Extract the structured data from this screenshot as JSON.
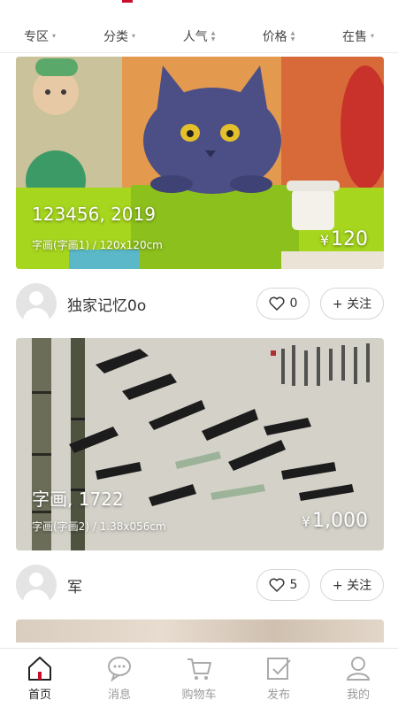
{
  "filters": [
    {
      "label": "专区",
      "indicator": "▾"
    },
    {
      "label": "分类",
      "indicator": "▾"
    },
    {
      "label": "人气",
      "indicator": "sort"
    },
    {
      "label": "价格",
      "indicator": "sort"
    },
    {
      "label": "在售",
      "indicator": "▾"
    }
  ],
  "cards": [
    {
      "title": "123456, 2019",
      "subtitle": "字画(字画1) / 120x120cm",
      "price_symbol": "¥",
      "price": "120",
      "user": "独家记忆0o",
      "likes": "0",
      "follow_label": "+ 关注",
      "image_icon": "cat-painting"
    },
    {
      "title": "字画, 1722",
      "subtitle": "字画(字画2) / 1.38x056cm",
      "price_symbol": "¥",
      "price": "1,000",
      "user": "军",
      "likes": "5",
      "follow_label": "+ 关注",
      "image_icon": "bamboo-painting"
    }
  ],
  "tabs": [
    {
      "label": "首页",
      "icon": "home-icon",
      "active": true
    },
    {
      "label": "消息",
      "icon": "message-icon",
      "active": false
    },
    {
      "label": "购物车",
      "icon": "cart-icon",
      "active": false
    },
    {
      "label": "发布",
      "icon": "publish-icon",
      "active": false
    },
    {
      "label": "我的",
      "icon": "profile-icon",
      "active": false
    }
  ],
  "colors": {
    "accent": "#c8102e",
    "active_tab": "#222222",
    "inactive_tab": "#9a9a9a"
  }
}
